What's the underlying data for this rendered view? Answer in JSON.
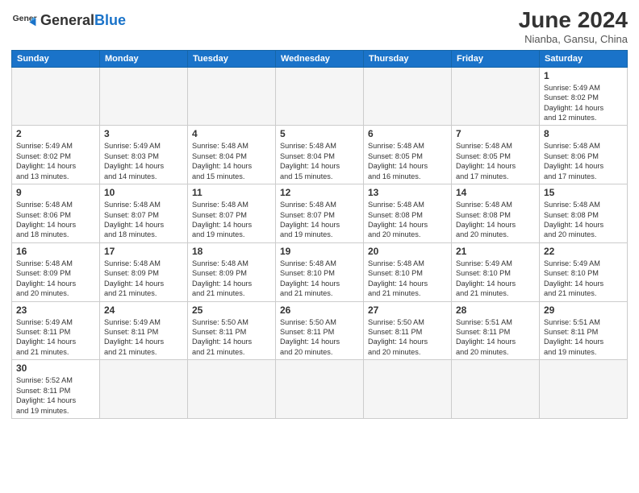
{
  "logo": {
    "text_general": "General",
    "text_blue": "Blue"
  },
  "title": "June 2024",
  "subtitle": "Nianba, Gansu, China",
  "weekdays": [
    "Sunday",
    "Monday",
    "Tuesday",
    "Wednesday",
    "Thursday",
    "Friday",
    "Saturday"
  ],
  "weeks": [
    [
      {
        "day": "",
        "info": ""
      },
      {
        "day": "",
        "info": ""
      },
      {
        "day": "",
        "info": ""
      },
      {
        "day": "",
        "info": ""
      },
      {
        "day": "",
        "info": ""
      },
      {
        "day": "",
        "info": ""
      },
      {
        "day": "1",
        "info": "Sunrise: 5:49 AM\nSunset: 8:02 PM\nDaylight: 14 hours\nand 12 minutes."
      }
    ],
    [
      {
        "day": "2",
        "info": "Sunrise: 5:49 AM\nSunset: 8:02 PM\nDaylight: 14 hours\nand 13 minutes."
      },
      {
        "day": "3",
        "info": "Sunrise: 5:49 AM\nSunset: 8:03 PM\nDaylight: 14 hours\nand 14 minutes."
      },
      {
        "day": "4",
        "info": "Sunrise: 5:48 AM\nSunset: 8:04 PM\nDaylight: 14 hours\nand 15 minutes."
      },
      {
        "day": "5",
        "info": "Sunrise: 5:48 AM\nSunset: 8:04 PM\nDaylight: 14 hours\nand 15 minutes."
      },
      {
        "day": "6",
        "info": "Sunrise: 5:48 AM\nSunset: 8:05 PM\nDaylight: 14 hours\nand 16 minutes."
      },
      {
        "day": "7",
        "info": "Sunrise: 5:48 AM\nSunset: 8:05 PM\nDaylight: 14 hours\nand 17 minutes."
      },
      {
        "day": "8",
        "info": "Sunrise: 5:48 AM\nSunset: 8:06 PM\nDaylight: 14 hours\nand 17 minutes."
      }
    ],
    [
      {
        "day": "9",
        "info": "Sunrise: 5:48 AM\nSunset: 8:06 PM\nDaylight: 14 hours\nand 18 minutes."
      },
      {
        "day": "10",
        "info": "Sunrise: 5:48 AM\nSunset: 8:07 PM\nDaylight: 14 hours\nand 18 minutes."
      },
      {
        "day": "11",
        "info": "Sunrise: 5:48 AM\nSunset: 8:07 PM\nDaylight: 14 hours\nand 19 minutes."
      },
      {
        "day": "12",
        "info": "Sunrise: 5:48 AM\nSunset: 8:07 PM\nDaylight: 14 hours\nand 19 minutes."
      },
      {
        "day": "13",
        "info": "Sunrise: 5:48 AM\nSunset: 8:08 PM\nDaylight: 14 hours\nand 20 minutes."
      },
      {
        "day": "14",
        "info": "Sunrise: 5:48 AM\nSunset: 8:08 PM\nDaylight: 14 hours\nand 20 minutes."
      },
      {
        "day": "15",
        "info": "Sunrise: 5:48 AM\nSunset: 8:08 PM\nDaylight: 14 hours\nand 20 minutes."
      }
    ],
    [
      {
        "day": "16",
        "info": "Sunrise: 5:48 AM\nSunset: 8:09 PM\nDaylight: 14 hours\nand 20 minutes."
      },
      {
        "day": "17",
        "info": "Sunrise: 5:48 AM\nSunset: 8:09 PM\nDaylight: 14 hours\nand 21 minutes."
      },
      {
        "day": "18",
        "info": "Sunrise: 5:48 AM\nSunset: 8:09 PM\nDaylight: 14 hours\nand 21 minutes."
      },
      {
        "day": "19",
        "info": "Sunrise: 5:48 AM\nSunset: 8:10 PM\nDaylight: 14 hours\nand 21 minutes."
      },
      {
        "day": "20",
        "info": "Sunrise: 5:48 AM\nSunset: 8:10 PM\nDaylight: 14 hours\nand 21 minutes."
      },
      {
        "day": "21",
        "info": "Sunrise: 5:49 AM\nSunset: 8:10 PM\nDaylight: 14 hours\nand 21 minutes."
      },
      {
        "day": "22",
        "info": "Sunrise: 5:49 AM\nSunset: 8:10 PM\nDaylight: 14 hours\nand 21 minutes."
      }
    ],
    [
      {
        "day": "23",
        "info": "Sunrise: 5:49 AM\nSunset: 8:11 PM\nDaylight: 14 hours\nand 21 minutes."
      },
      {
        "day": "24",
        "info": "Sunrise: 5:49 AM\nSunset: 8:11 PM\nDaylight: 14 hours\nand 21 minutes."
      },
      {
        "day": "25",
        "info": "Sunrise: 5:50 AM\nSunset: 8:11 PM\nDaylight: 14 hours\nand 21 minutes."
      },
      {
        "day": "26",
        "info": "Sunrise: 5:50 AM\nSunset: 8:11 PM\nDaylight: 14 hours\nand 20 minutes."
      },
      {
        "day": "27",
        "info": "Sunrise: 5:50 AM\nSunset: 8:11 PM\nDaylight: 14 hours\nand 20 minutes."
      },
      {
        "day": "28",
        "info": "Sunrise: 5:51 AM\nSunset: 8:11 PM\nDaylight: 14 hours\nand 20 minutes."
      },
      {
        "day": "29",
        "info": "Sunrise: 5:51 AM\nSunset: 8:11 PM\nDaylight: 14 hours\nand 19 minutes."
      }
    ],
    [
      {
        "day": "30",
        "info": "Sunrise: 5:52 AM\nSunset: 8:11 PM\nDaylight: 14 hours\nand 19 minutes."
      },
      {
        "day": "",
        "info": ""
      },
      {
        "day": "",
        "info": ""
      },
      {
        "day": "",
        "info": ""
      },
      {
        "day": "",
        "info": ""
      },
      {
        "day": "",
        "info": ""
      },
      {
        "day": "",
        "info": ""
      }
    ]
  ]
}
